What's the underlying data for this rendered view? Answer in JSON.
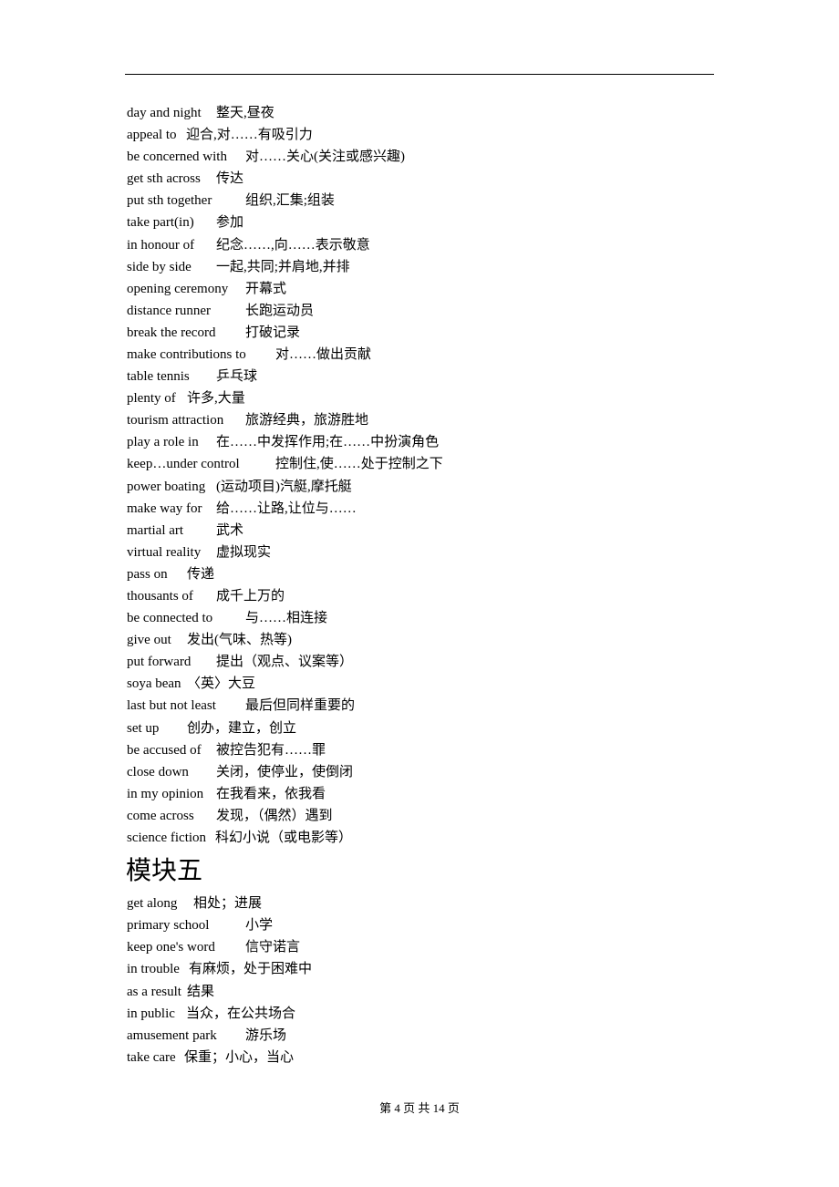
{
  "section_a": {
    "entries": [
      {
        "term": "day and night",
        "meaning": "整天,昼夜"
      },
      {
        "term": "appeal to",
        "meaning": "迎合,对……有吸引力"
      },
      {
        "term": "be concerned with",
        "meaning": "对……关心(关注或感兴趣)"
      },
      {
        "term": "get sth across",
        "meaning": "传达"
      },
      {
        "term": "put sth together",
        "meaning": "组织,汇集;组装"
      },
      {
        "term": "take part(in)",
        "meaning": "参加"
      },
      {
        "term": "in honour of",
        "meaning": "纪念……,向……表示敬意"
      },
      {
        "term": "side by side",
        "meaning": "一起,共同;并肩地,并排"
      },
      {
        "term": "opening ceremony",
        "meaning": "开幕式"
      },
      {
        "term": "distance runner",
        "meaning": "长跑运动员"
      },
      {
        "term": "break the record",
        "meaning": "打破记录"
      },
      {
        "term": "make contributions to",
        "meaning": "对……做出贡献"
      },
      {
        "term": "table tennis",
        "meaning": "乒乓球"
      },
      {
        "term": "plenty of",
        "meaning": "许多,大量"
      },
      {
        "term": "tourism attraction",
        "meaning": "旅游经典，旅游胜地"
      },
      {
        "term": "play a role in",
        "meaning": "在……中发挥作用;在……中扮演角色"
      },
      {
        "term": "keep…under control",
        "meaning": "控制住,使……处于控制之下"
      },
      {
        "term": "power boating",
        "meaning": "(运动项目)汽艇,摩托艇"
      },
      {
        "term": "make way for",
        "meaning": "给……让路,让位与……"
      },
      {
        "term": "martial art",
        "meaning": "武术"
      },
      {
        "term": "virtual reality",
        "meaning": "虚拟现实"
      },
      {
        "term": "pass on",
        "meaning": "传递"
      },
      {
        "term": "thousants of",
        "meaning": "成千上万的"
      },
      {
        "term": "be connected to",
        "meaning": "与……相连接"
      },
      {
        "term": "give out",
        "meaning": "发出(气味、热等)"
      },
      {
        "term": "put forward",
        "meaning": "提出（观点、议案等）"
      },
      {
        "term": "soya bean",
        "meaning": "〈英〉大豆"
      },
      {
        "term": "last but not least",
        "meaning": "最后但同样重要的"
      },
      {
        "term": "set up",
        "meaning": "创办，建立，创立"
      },
      {
        "term": "be accused of",
        "meaning": "被控告犯有……罪"
      },
      {
        "term": "close down",
        "meaning": "关闭，使停业，使倒闭"
      },
      {
        "term": "in my opinion",
        "meaning": "在我看来，依我看"
      },
      {
        "term": "come across",
        "meaning": "发现，（偶然）遇到"
      },
      {
        "term": "science fiction",
        "meaning": "科幻小说（或电影等）"
      }
    ]
  },
  "section_b": {
    "heading": "模块五",
    "entries": [
      {
        "term": "get along",
        "meaning": "相处；进展"
      },
      {
        "term": "primary school",
        "meaning": "小学"
      },
      {
        "term": "keep one's word",
        "meaning": "信守诺言"
      },
      {
        "term": "in trouble",
        "meaning": "有麻烦，处于困难中"
      },
      {
        "term": "as a result",
        "meaning": "结果"
      },
      {
        "term": "in public",
        "meaning": "当众，在公共场合"
      },
      {
        "term": "amusement park",
        "meaning": "游乐场"
      },
      {
        "term": "take care",
        "meaning": "保重；小心，当心"
      }
    ]
  },
  "footer": {
    "page_label": "第 4 页 共 14 页"
  }
}
